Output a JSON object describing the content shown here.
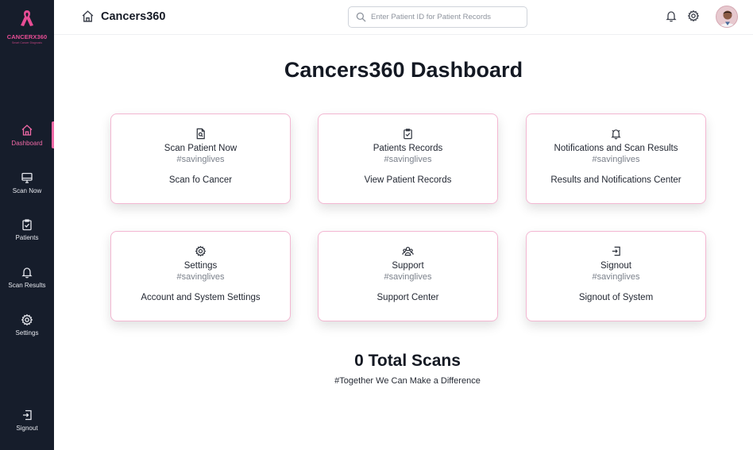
{
  "brand": {
    "logo_text": "CANCERX360",
    "logo_sub": "Smart Cancer Diagnosis",
    "accent": "#e84d95"
  },
  "sidebar": {
    "items": [
      {
        "label": "Dashboard",
        "icon": "home-icon",
        "active": true
      },
      {
        "label": "Scan Now",
        "icon": "monitor-icon"
      },
      {
        "label": "Patients",
        "icon": "clipboard-check-icon"
      },
      {
        "label": "Scan Results",
        "icon": "bell-icon"
      },
      {
        "label": "Settings",
        "icon": "gear-icon"
      },
      {
        "label": "Signout",
        "icon": "signout-icon"
      }
    ]
  },
  "header": {
    "app_name": "Cancers360",
    "search_placeholder": "Enter Patient ID for Patient Records"
  },
  "main": {
    "title": "Cancers360 Dashboard",
    "cards": [
      {
        "title": "Scan Patient Now",
        "tag": "#savinglives",
        "desc": "Scan fo Cancer",
        "icon": "file-search-icon"
      },
      {
        "title": "Patients Records",
        "tag": "#savinglives",
        "desc": "View Patient Records",
        "icon": "clipboard-check-icon"
      },
      {
        "title": "Notifications and Scan Results",
        "tag": "#savinglives",
        "desc": "Results and Notifications Center",
        "icon": "bell-icon"
      },
      {
        "title": "Settings",
        "tag": "#savinglives",
        "desc": "Account and System Settings",
        "icon": "gear-icon"
      },
      {
        "title": "Support",
        "tag": "#savinglives",
        "desc": "Support Center",
        "icon": "users-icon"
      },
      {
        "title": "Signout",
        "tag": "#savinglives",
        "desc": "Signout of System",
        "icon": "signout-icon"
      }
    ],
    "total_scans": "0 Total Scans",
    "tagline": "#Together We Can Make a Difference"
  }
}
